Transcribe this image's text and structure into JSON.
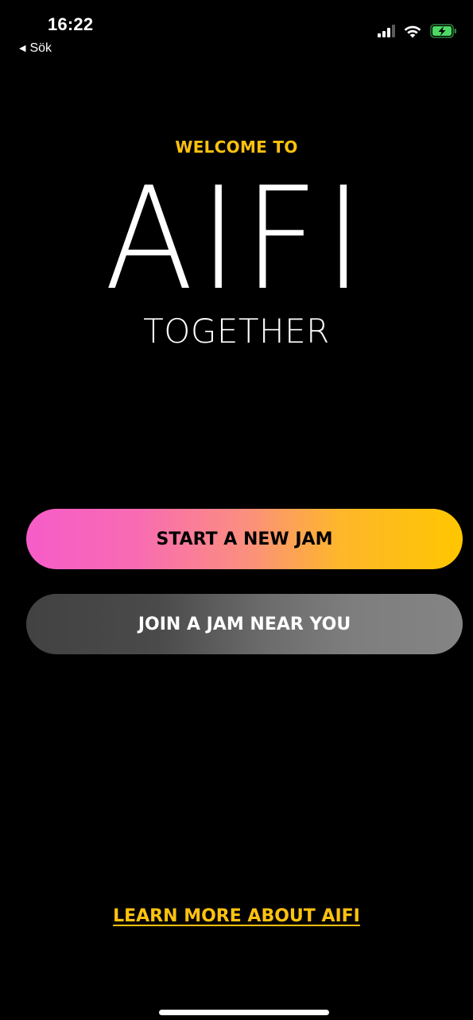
{
  "status_bar": {
    "time": "16:22",
    "back_label": "Sök",
    "icons": [
      "signal-icon",
      "wifi-icon",
      "battery-charging-icon"
    ]
  },
  "hero": {
    "welcome": "WELCOME TO",
    "logo": "AIFI",
    "tagline": "TOGETHER"
  },
  "actions": {
    "start_label": "START A NEW JAM",
    "join_label": "JOIN A JAM NEAR YOU"
  },
  "footer": {
    "learn_more_label": "LEARN MORE ABOUT AIFI"
  },
  "colors": {
    "background": "#000000",
    "accent_yellow": "#ffc20e",
    "start_gradient_from": "#f65cc8",
    "start_gradient_to": "#ffc600",
    "join_gradient_from": "#424242",
    "join_gradient_to": "#848484",
    "battery_green": "#4cd964"
  }
}
